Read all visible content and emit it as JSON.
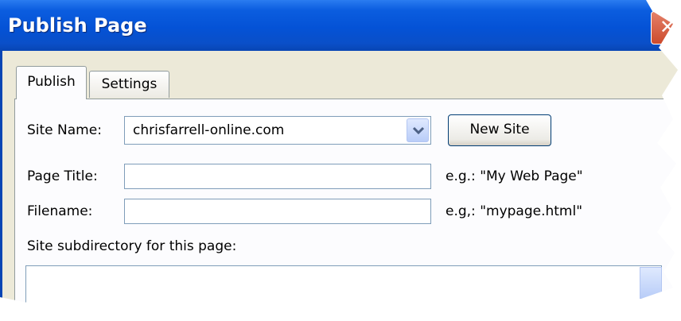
{
  "window": {
    "title": "Publish Page",
    "close_glyph": "✕"
  },
  "tabs": [
    {
      "label": "Publish",
      "selected": true
    },
    {
      "label": "Settings",
      "selected": false
    }
  ],
  "form": {
    "site_name_label": "Site Name:",
    "site_name_value": "chrisfarrell-online.com",
    "new_site_button": "New Site",
    "page_title_label": "Page Title:",
    "page_title_value": "",
    "page_title_hint": "e.g.: \"My Web Page\"",
    "filename_label": "Filename:",
    "filename_value": "",
    "filename_hint": "e.g,: \"mypage.html\"",
    "subdir_label": "Site subdirectory for this page:"
  },
  "icons": {
    "dropdown": "chevron-down-icon",
    "close": "close-icon"
  },
  "colors": {
    "titlebar": "#0452d6",
    "dialog_bg": "#ece9d8",
    "panel_bg": "#fcfcfe",
    "field_border": "#7f9db9"
  }
}
